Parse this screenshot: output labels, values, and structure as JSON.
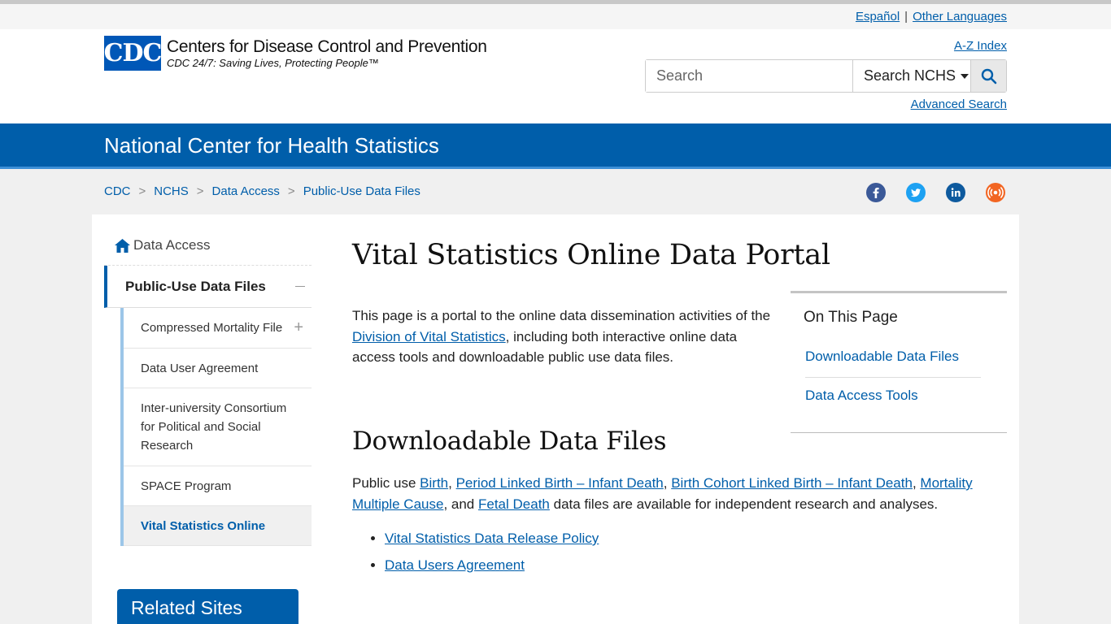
{
  "lang": {
    "espanol": "Español",
    "separator": "|",
    "other": "Other Languages"
  },
  "header": {
    "logo_mark": "CDC",
    "logo_title": "Centers for Disease Control and Prevention",
    "logo_tagline": "CDC 24/7: Saving Lives, Protecting People™",
    "az_index": "A-Z Index",
    "search_placeholder": "Search",
    "search_scope": "Search NCHS",
    "advanced_search": "Advanced Search"
  },
  "banner": {
    "title": "National Center for Health Statistics"
  },
  "breadcrumbs": [
    "CDC",
    "NCHS",
    "Data Access",
    "Public-Use Data Files"
  ],
  "breadcrumb_sep": ">",
  "social": [
    "facebook-icon",
    "twitter-icon",
    "linkedin-icon",
    "syndicate-icon"
  ],
  "sidebar": {
    "home": "Data Access",
    "current": "Public-Use Data Files",
    "items": [
      {
        "label": "Compressed Mortality File"
      },
      {
        "label": "Data User Agreement"
      },
      {
        "label": "Inter-university Consortium for Political and Social Research"
      },
      {
        "label": "SPACE Program"
      },
      {
        "label": "Vital Statistics Online"
      }
    ],
    "related": "Related Sites"
  },
  "main": {
    "title": "Vital Statistics Online Data Portal",
    "intro_pre": "This page is a portal to the online data dissemination activities of the ",
    "intro_link": "Division of Vital Statistics",
    "intro_post": ", including both interactive online data access tools and downloadable public use data files.",
    "otp_title": "On This Page",
    "otp_links": [
      "Downloadable Data Files",
      "Data Access Tools"
    ],
    "h2": "Downloadable Data Files",
    "dl_pre": "Public use ",
    "dl_links": [
      "Birth",
      "Period Linked Birth – Infant Death",
      "Birth Cohort Linked Birth – Infant Death",
      "Mortality Multiple Cause",
      "Fetal Death"
    ],
    "dl_sep": ", ",
    "dl_and": ", and ",
    "dl_post": " data files are available for independent research and analyses.",
    "list": [
      "Vital Statistics Data Release Policy",
      "Data Users Agreement"
    ]
  },
  "colors": {
    "brand": "#005eaa",
    "accent_light": "#9cc6e8",
    "facebook": "#3b5998",
    "twitter": "#1da1f2",
    "linkedin": "#0e5a9e",
    "syndicate": "#f26522"
  }
}
